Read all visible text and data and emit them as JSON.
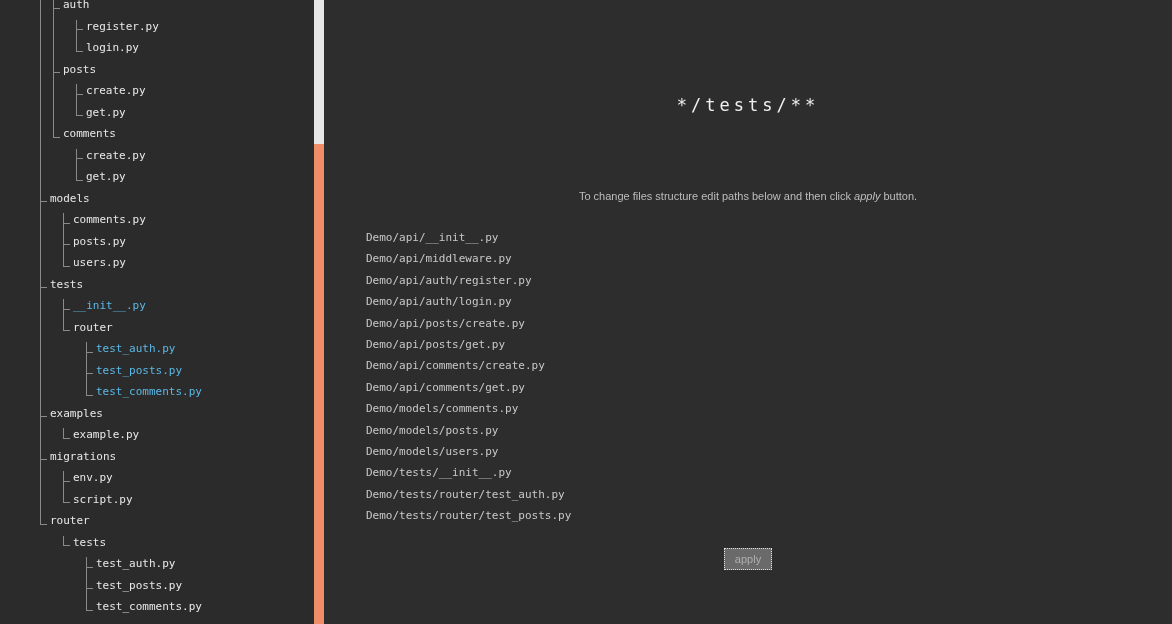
{
  "tree": [
    {
      "children": [
        {
          "label": "auth",
          "highlighted": false,
          "children": [
            {
              "label": "register.py",
              "highlighted": false
            },
            {
              "label": "login.py",
              "highlighted": false
            }
          ]
        },
        {
          "label": "posts",
          "highlighted": false,
          "children": [
            {
              "label": "create.py",
              "highlighted": false
            },
            {
              "label": "get.py",
              "highlighted": false
            }
          ]
        },
        {
          "label": "comments",
          "highlighted": false,
          "children": [
            {
              "label": "create.py",
              "highlighted": false
            },
            {
              "label": "get.py",
              "highlighted": false
            }
          ]
        }
      ]
    },
    {
      "label": "models",
      "highlighted": false,
      "children": [
        {
          "label": "comments.py",
          "highlighted": false
        },
        {
          "label": "posts.py",
          "highlighted": false
        },
        {
          "label": "users.py",
          "highlighted": false
        }
      ]
    },
    {
      "label": "tests",
      "highlighted": false,
      "children": [
        {
          "label": "__init__.py",
          "highlighted": true
        },
        {
          "label": "router",
          "highlighted": false,
          "children": [
            {
              "label": "test_auth.py",
              "highlighted": true
            },
            {
              "label": "test_posts.py",
              "highlighted": true
            },
            {
              "label": "test_comments.py",
              "highlighted": true
            }
          ]
        }
      ]
    },
    {
      "label": "examples",
      "highlighted": false,
      "children": [
        {
          "label": "example.py",
          "highlighted": false
        }
      ]
    },
    {
      "label": "migrations",
      "highlighted": false,
      "children": [
        {
          "label": "env.py",
          "highlighted": false
        },
        {
          "label": "script.py",
          "highlighted": false
        }
      ]
    },
    {
      "label": "router",
      "highlighted": false,
      "children": [
        {
          "label": "tests",
          "highlighted": false,
          "children": [
            {
              "label": "test_auth.py",
              "highlighted": false
            },
            {
              "label": "test_posts.py",
              "highlighted": false
            },
            {
              "label": "test_comments.py",
              "highlighted": false
            }
          ]
        }
      ]
    }
  ],
  "pattern": "*/tests/**",
  "hint": "To change files structure edit paths below and then click *apply* button.",
  "paths": [
    "Demo/api/__init__.py",
    "Demo/api/middleware.py",
    "Demo/api/auth/register.py",
    "Demo/api/auth/login.py",
    "Demo/api/posts/create.py",
    "Demo/api/posts/get.py",
    "Demo/api/comments/create.py",
    "Demo/api/comments/get.py",
    "Demo/models/comments.py",
    "Demo/models/posts.py",
    "Demo/models/users.py",
    "Demo/tests/__init__.py",
    "Demo/tests/router/test_auth.py",
    "Demo/tests/router/test_posts.py"
  ],
  "apply_button": "apply"
}
